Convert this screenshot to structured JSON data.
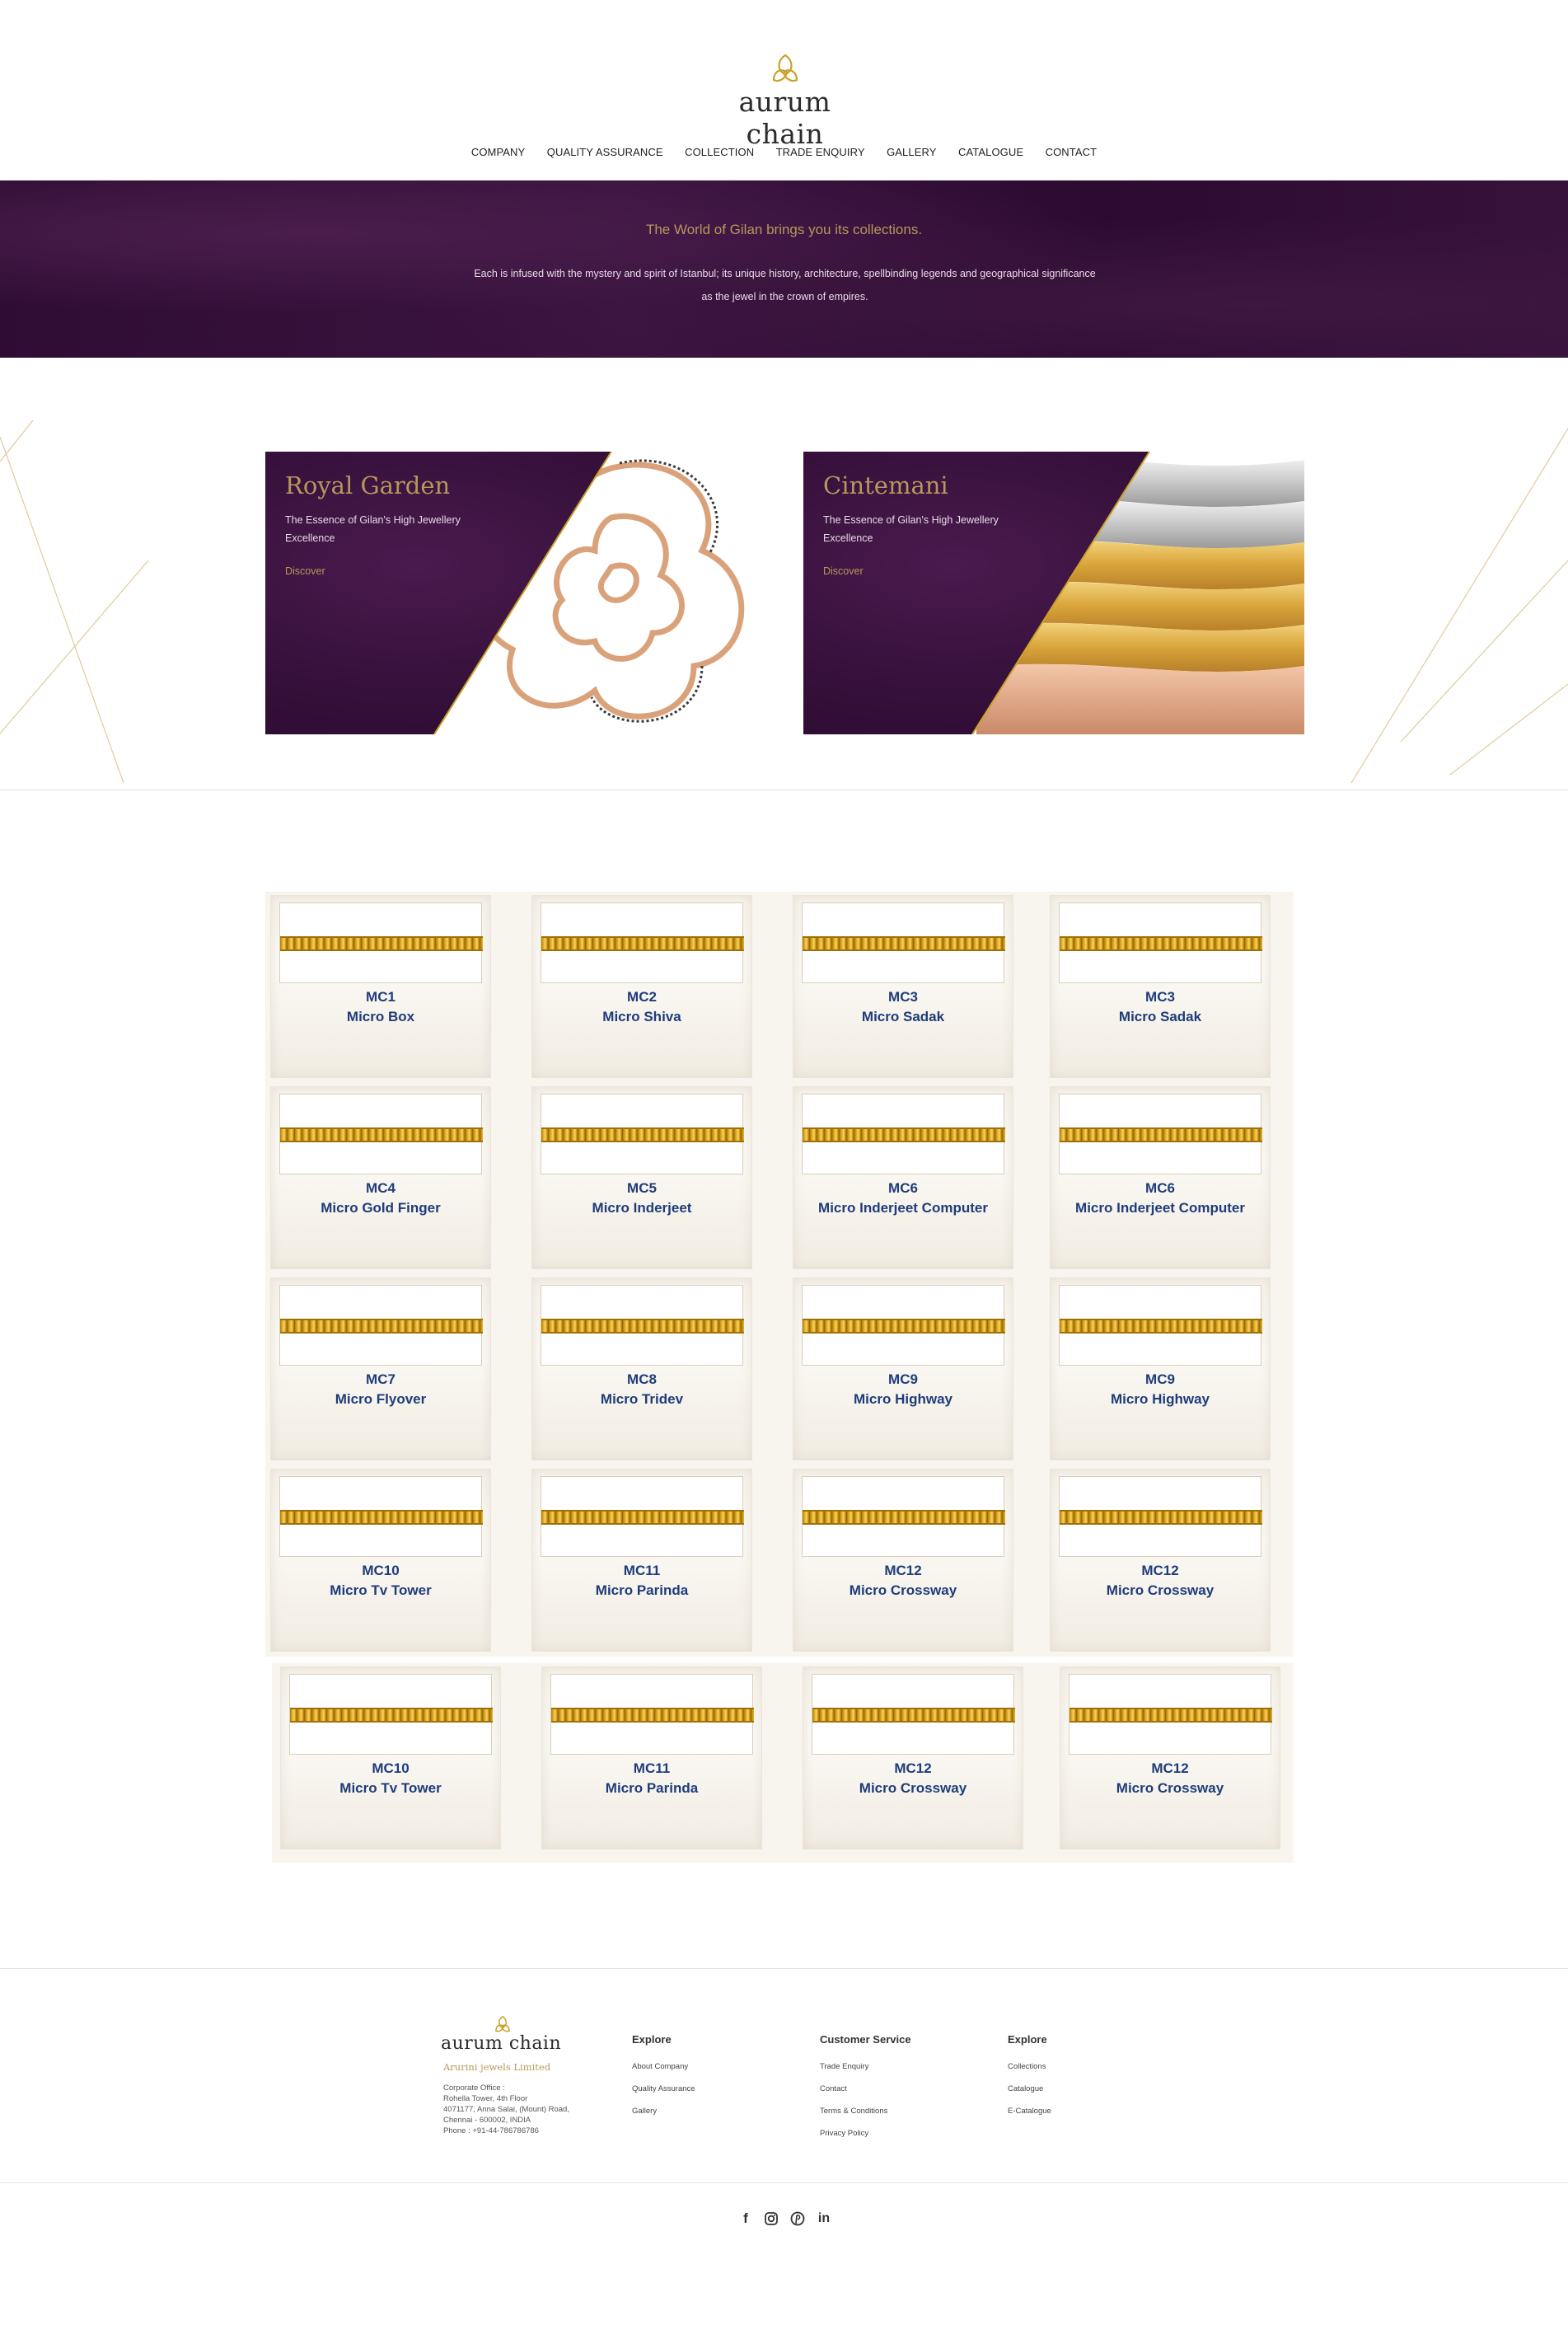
{
  "header": {
    "logo_text": "aurum chain",
    "nav": [
      "COMPANY",
      "QUALITY ASSURANCE",
      "COLLECTION",
      "TRADE ENQUIRY",
      "GALLERY",
      "CATALOGUE",
      "CONTACT"
    ]
  },
  "hero": {
    "title": "The World of Gilan brings you its collections.",
    "text": "Each is infused with the mystery and spirit of Istanbul; its unique history, architecture, spellbinding legends and geographical significance as the jewel in the crown of empires."
  },
  "features": [
    {
      "title": "Royal Garden",
      "text": "The Essence of Gilan's High Jewellery Excellence",
      "link": "Discover"
    },
    {
      "title": "Cintemani",
      "text": "The Essence of Gilan's High Jewellery Excellence",
      "link": "Discover"
    }
  ],
  "products": [
    {
      "code": "MC1",
      "name": "Micro Box"
    },
    {
      "code": "MC2",
      "name": "Micro Shiva"
    },
    {
      "code": "MC3",
      "name": "Micro Sadak"
    },
    {
      "code": "MC3",
      "name": "Micro Sadak"
    },
    {
      "code": "MC4",
      "name": "Micro Gold Finger"
    },
    {
      "code": "MC5",
      "name": "Micro Inderjeet"
    },
    {
      "code": "MC6",
      "name": "Micro Inderjeet Computer"
    },
    {
      "code": "MC6",
      "name": "Micro Inderjeet Computer"
    },
    {
      "code": "MC7",
      "name": "Micro Flyover"
    },
    {
      "code": "MC8",
      "name": "Micro Tridev"
    },
    {
      "code": "MC9",
      "name": "Micro Highway"
    },
    {
      "code": "MC9",
      "name": "Micro Highway"
    },
    {
      "code": "MC10",
      "name": "Micro Tv Tower"
    },
    {
      "code": "MC11",
      "name": "Micro Parinda"
    },
    {
      "code": "MC12",
      "name": "Micro Crossway"
    },
    {
      "code": "MC12",
      "name": "Micro Crossway"
    },
    {
      "code": "MC10",
      "name": "Micro Tv Tower"
    },
    {
      "code": "MC11",
      "name": "Micro Parinda"
    },
    {
      "code": "MC12",
      "name": "Micro Crossway"
    },
    {
      "code": "MC12",
      "name": "Micro Crossway"
    }
  ],
  "footer": {
    "logo_text": "aurum chain",
    "company": "Arurini jewels Limited",
    "address": "Corporate Office :\nRohella Tower, 4th Floor\n4071177, Anna Salai, (Mount) Road,\nChennai - 600002, INDIA\nPhone : +91-44-786786786",
    "columns": [
      {
        "heading": "Explore",
        "links": [
          "About Company",
          "Quality Assurance",
          "Gallery"
        ]
      },
      {
        "heading": "Customer Service",
        "links": [
          "Trade Enquiry",
          "Contact",
          "Terms & Conditions",
          "Privacy Policy"
        ]
      },
      {
        "heading": "Explore",
        "links": [
          "Collections",
          "Catalogue",
          "E-Catalogue"
        ]
      }
    ],
    "social": [
      "facebook-icon",
      "instagram-icon",
      "pinterest-icon",
      "linkedin-icon"
    ]
  },
  "colors": {
    "gold": "#b8975a",
    "purple": "#35103a",
    "product_text": "#1f3c7a"
  }
}
